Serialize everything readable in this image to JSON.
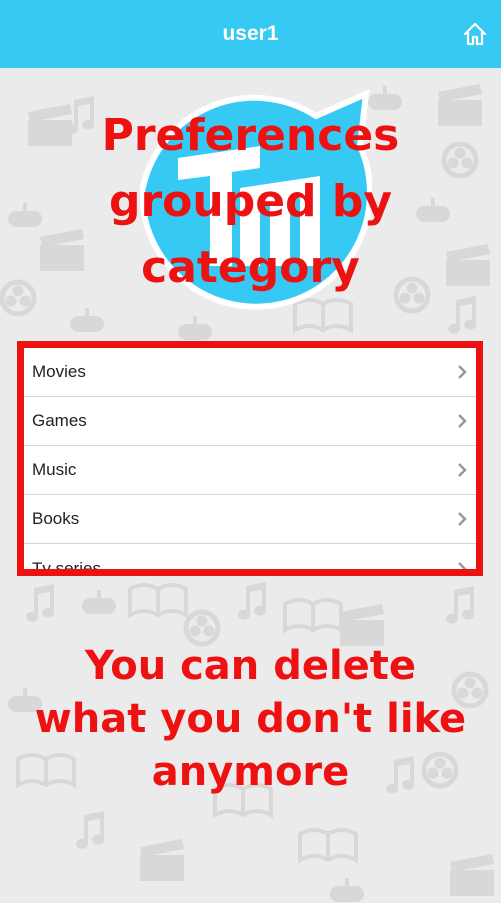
{
  "header": {
    "title": "user1",
    "home_icon": "home-icon"
  },
  "logo": {
    "icon": "logo-icon",
    "color": "#35c9f4"
  },
  "annotations": {
    "top": "Preferences\ngrouped by\ncategory",
    "bottom": "You can delete\nwhat you don't like\nanymore"
  },
  "categories": [
    {
      "label": "Movies"
    },
    {
      "label": "Games"
    },
    {
      "label": "Music"
    },
    {
      "label": "Books"
    },
    {
      "label": "Tv series"
    }
  ],
  "colors": {
    "header": "#35c9f4",
    "annotation": "#ee1111",
    "background": "#ebebeb"
  }
}
